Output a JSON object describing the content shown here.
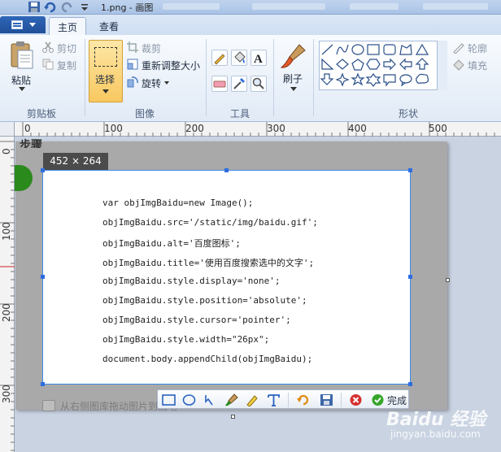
{
  "window": {
    "title": "1.png - 画图"
  },
  "tabs": [
    {
      "label": "主页",
      "active": true
    },
    {
      "label": "查看",
      "active": false
    }
  ],
  "clipboard": {
    "paste_label": "粘贴",
    "cut_label": "剪切",
    "copy_label": "复制",
    "group_label": "剪贴板"
  },
  "image": {
    "select_label": "选择",
    "crop_label": "裁剪",
    "resize_label": "重新调整大小",
    "rotate_label": "旋转",
    "group_label": "图像"
  },
  "tools": {
    "group_label": "工具",
    "brush_label": "刷子"
  },
  "shapes": {
    "outline_label": "轮廓",
    "fill_label": "填充",
    "group_label": "形状"
  },
  "ruler": {
    "h_labels": [
      "0",
      "100",
      "200",
      "300",
      "400",
      "500"
    ],
    "v_labels": [
      "0",
      "100",
      "200",
      "300"
    ]
  },
  "canvas": {
    "selection_size": "452 × 264",
    "code_lines": [
      "var objImgBaidu=new Image();",
      "objImgBaidu.src='/static/img/baidu.gif';",
      "objImgBaidu.alt='百度图标';",
      "objImgBaidu.title='使用百度搜索选中的文字';",
      "objImgBaidu.style.display='none';",
      "objImgBaidu.style.position='absolute';",
      "objImgBaidu.style.cursor='pointer';",
      "objImgBaidu.style.width=\"26px\";",
      "document.body.appendChild(objImgBaidu);"
    ],
    "hint": "从右侧图库拖动图片到画笔"
  },
  "floatbar": {
    "done_label": "完成"
  },
  "watermark": {
    "brand": "Baidu 经验",
    "url": "jingyan.baidu.com"
  },
  "colors": {
    "accent": "#2f66b8",
    "selection": "#3c8be8",
    "select_active": "#f8c860"
  }
}
